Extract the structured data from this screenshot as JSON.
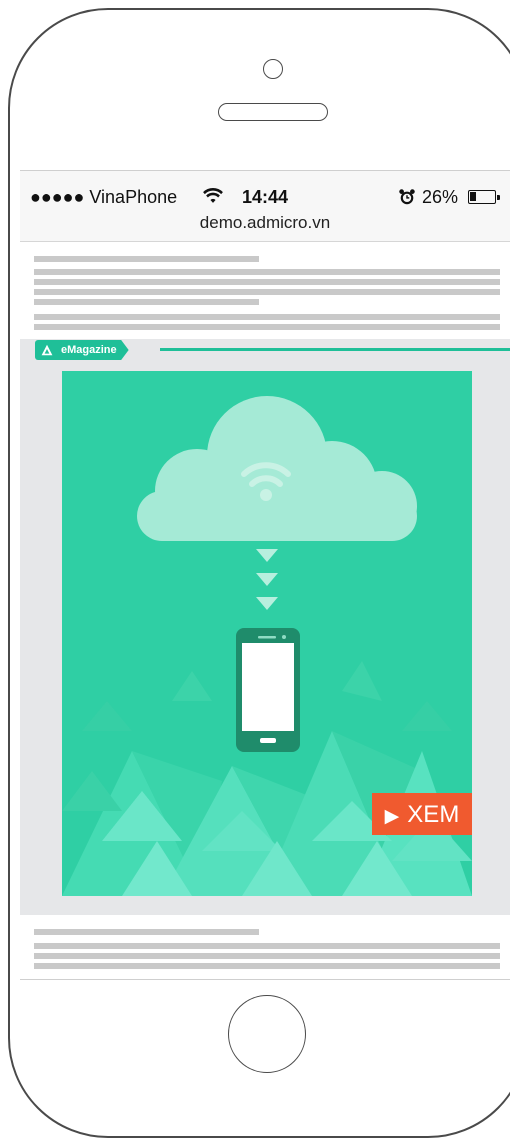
{
  "status_bar": {
    "carrier": "●●●●● VinaPhone",
    "time": "14:44",
    "battery_percent": "26%",
    "battery_level": 0.26,
    "wifi_icon": "wifi-icon",
    "alarm_icon": "alarm-clock-icon"
  },
  "browser": {
    "url": "demo.admicro.vn"
  },
  "ad": {
    "tag_label": "eMagazine",
    "tag_color": "#1fbf98",
    "banner_color": "#2fcfa4",
    "cta_label": "XEM",
    "cta_color": "#f05a2f",
    "icons": [
      "cloud-icon",
      "wifi-icon",
      "arrow-down-icon",
      "smartphone-icon"
    ]
  }
}
